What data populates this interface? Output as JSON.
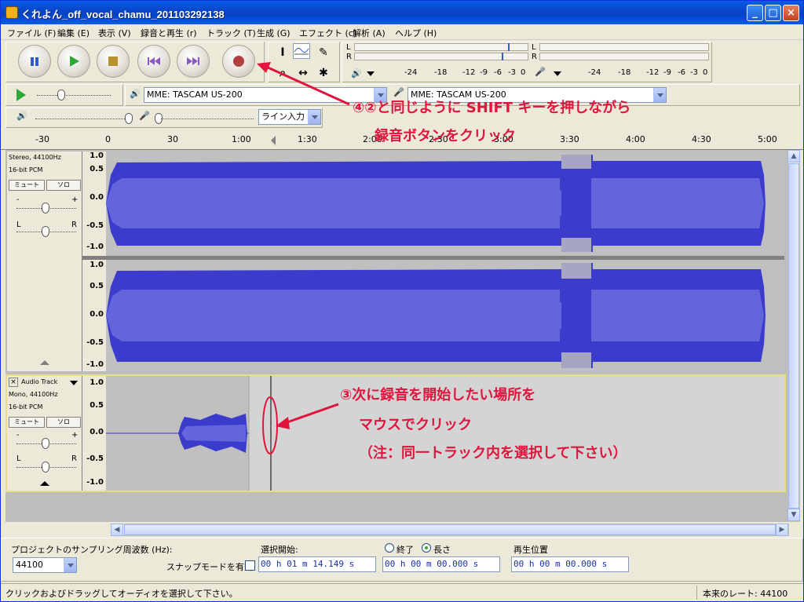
{
  "window": {
    "title": "くれよん_off_vocal_chamu_201103292138"
  },
  "menu": [
    "ファイル (F)",
    "編集 (E)",
    "表示 (V)",
    "録音と再生 (r)",
    "トラック (T)",
    "生成 (G)",
    "エフェクト (c)",
    "解析 (A)",
    "ヘルプ (H)"
  ],
  "meters": {
    "left_label": "L",
    "right_label": "R",
    "ticks": [
      "-24",
      "-18",
      "-12",
      "-9",
      "-6",
      "-3",
      "0"
    ]
  },
  "devices": {
    "playback_device": "MME: TASCAM US-200",
    "record_device": "MME: TASCAM US-200",
    "input_source": "ライン入力"
  },
  "ruler": {
    "labels": [
      "-30",
      "0",
      "30",
      "1:00",
      "1:30",
      "2:00",
      "2:30",
      "3:00",
      "3:30",
      "4:00",
      "4:30",
      "5:00"
    ]
  },
  "tracks": [
    {
      "name": "",
      "format1": "Stereo, 44100Hz",
      "format2": "16-bit PCM",
      "mute": "ミュート",
      "solo": "ソロ",
      "gain_minus": "-",
      "gain_plus": "+",
      "pan_left": "L",
      "pan_right": "R",
      "scale": [
        "1.0",
        "0.5",
        "0.0",
        "-0.5",
        "-1.0"
      ]
    },
    {
      "name": "Audio Track",
      "format1": "Mono, 44100Hz",
      "format2": "16-bit PCM",
      "mute": "ミュート",
      "solo": "ソロ",
      "gain_minus": "-",
      "gain_plus": "+",
      "pan_left": "L",
      "pan_right": "R",
      "scale": [
        "1.0",
        "0.5",
        "0.0",
        "-0.5",
        "-1.0"
      ]
    }
  ],
  "annotations": {
    "step4_line1": "④②と同じように SHIFT キーを押しながら",
    "step4_line2": "録音ボタンをクリック",
    "step3_line1": "③次に録音を開始したい場所を",
    "step3_line2": "マウスでクリック",
    "step3_line3": "（注：同一トラック内を選択して下さい）"
  },
  "selection_bar": {
    "rate_label": "プロジェクトのサンプリング周波数 (Hz):",
    "rate_value": "44100",
    "snap_label": "スナップモードを有効",
    "sel_start_label": "選択開始:",
    "end_label": "終了",
    "length_label": "長さ",
    "sel_start_value": "00 h 01 m 14.149 s",
    "sel_length_value": "00 h 00 m 00.000 s",
    "play_pos_label": "再生位置",
    "play_pos_value": "00 h 00 m 00.000 s"
  },
  "status": {
    "hint": "クリックおよびドラッグしてオーディオを選択して下さい。",
    "actual_rate": "本来のレート: 44100"
  },
  "colors": {
    "waveform": "#3c3ccc",
    "waveform_rms": "#6464dc",
    "annotation": "#e0143c",
    "record_button": "#b0413e"
  }
}
